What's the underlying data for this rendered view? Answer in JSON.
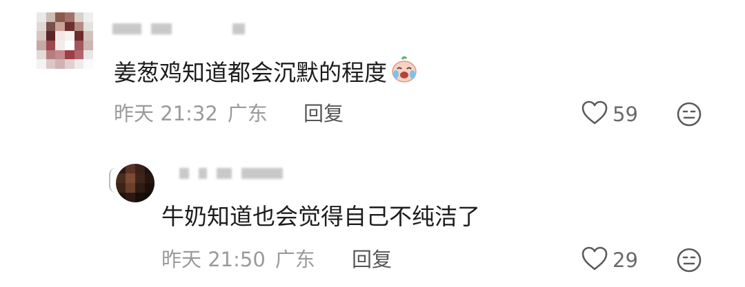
{
  "comments": [
    {
      "text": "姜葱鸡知道都会沉默的程度",
      "emoji": "crying-laughing-emoji",
      "time": "昨天 21:32",
      "location": "广东",
      "reply_label": "回复",
      "likes": "59"
    },
    {
      "text": "牛奶知道也会觉得自己不纯洁了",
      "time": "昨天 21:50",
      "location": "广东",
      "reply_label": "回复",
      "likes": "29"
    }
  ],
  "icons": {
    "like": "heart-outline-icon",
    "dislike": "meh-face-icon"
  },
  "colors": {
    "text": "#1c1c1c",
    "meta": "#9a9a9a",
    "reply": "#555555",
    "icon": "#5a5a5a"
  }
}
